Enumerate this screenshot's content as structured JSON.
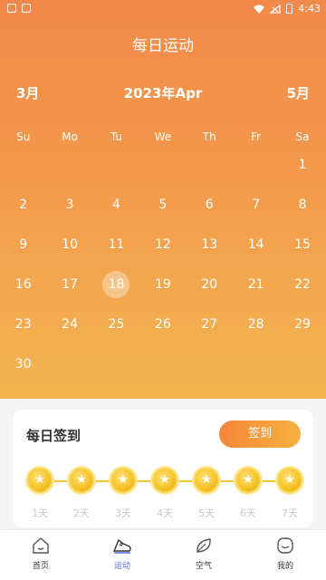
{
  "status": {
    "time": "4:43"
  },
  "header": {
    "title": "每日运动"
  },
  "calendar": {
    "prev": "3月",
    "current": "2023年Apr",
    "next": "5月",
    "weekdays": [
      "Su",
      "Mo",
      "Tu",
      "We",
      "Th",
      "Fr",
      "Sa"
    ],
    "weeks": [
      [
        "",
        "",
        "",
        "",
        "",
        "",
        "1"
      ],
      [
        "2",
        "3",
        "4",
        "5",
        "6",
        "7",
        "8"
      ],
      [
        "9",
        "10",
        "11",
        "12",
        "13",
        "14",
        "15"
      ],
      [
        "16",
        "17",
        "18",
        "19",
        "20",
        "21",
        "22"
      ],
      [
        "23",
        "24",
        "25",
        "26",
        "27",
        "28",
        "29"
      ],
      [
        "30",
        "",
        "",
        "",
        "",
        "",
        ""
      ]
    ],
    "today": "18"
  },
  "signin": {
    "title": "每日签到",
    "button": "签到",
    "days": [
      "1天",
      "2天",
      "3天",
      "4天",
      "5天",
      "6天",
      "7天"
    ],
    "coin_symbol": "★"
  },
  "tabs": [
    {
      "label": "首页",
      "icon": "home-icon"
    },
    {
      "label": "运动",
      "icon": "running-shoe-icon"
    },
    {
      "label": "空气",
      "icon": "leaf-icon"
    },
    {
      "label": "我的",
      "icon": "profile-icon"
    }
  ],
  "active_tab": "运动"
}
